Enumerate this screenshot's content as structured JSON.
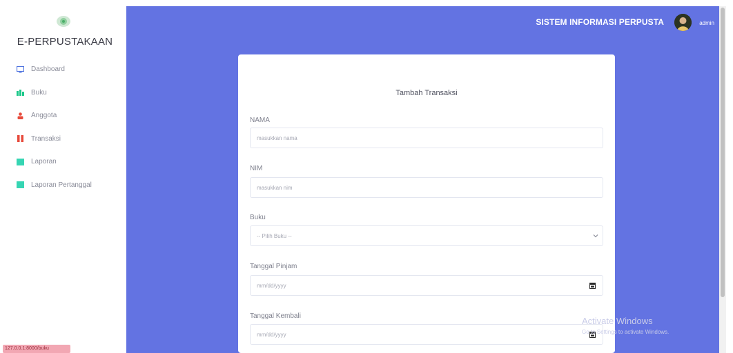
{
  "sidebar": {
    "brand": "E-PERPUSTAKAAN",
    "items": [
      {
        "label": "Dashboard",
        "icon": "monitor-icon",
        "color": "#4e73df"
      },
      {
        "label": "Buku",
        "icon": "book-icon",
        "color": "#1cc88a"
      },
      {
        "label": "Anggota",
        "icon": "user-icon",
        "color": "#e74a3b"
      },
      {
        "label": "Transaksi",
        "icon": "transaction-icon",
        "color": "#e74a3b"
      },
      {
        "label": "Laporan",
        "icon": "report-icon",
        "color": "#36d5b3"
      },
      {
        "label": "Laporan Pertanggal",
        "icon": "report-date-icon",
        "color": "#36d5b3"
      }
    ],
    "ip_badge": "127.0.0.1:8000/buku"
  },
  "topbar": {
    "title": "SISTEM INFORMASI PERPUSTA",
    "user": "admin"
  },
  "form": {
    "title": "Tambah Transaksi",
    "fields": [
      {
        "label": "NAMA",
        "placeholder": "masukkan nama"
      },
      {
        "label": "NIM",
        "placeholder": "masukkan nim"
      },
      {
        "label": "Buku",
        "selected": "-- Pilih Buku --"
      },
      {
        "label": "Tanggal Pinjam",
        "value": "mm/dd/yyyy"
      },
      {
        "label": "Tanggal Kembali",
        "value": "mm/dd/yyyy"
      }
    ]
  },
  "watermark": {
    "title": "Activate Windows",
    "subtitle": "Go to Settings to activate Windows."
  },
  "colors": {
    "accent": "#6373e2",
    "card": "#ffffff"
  }
}
